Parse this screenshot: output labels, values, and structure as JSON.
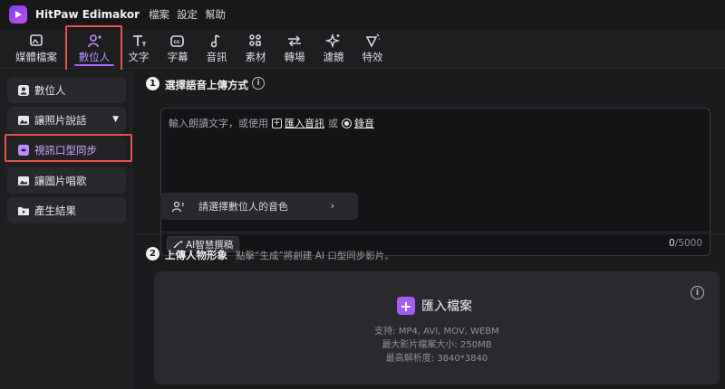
{
  "app": {
    "name": "HitPaw Edimakor"
  },
  "menu": [
    "檔案",
    "設定",
    "幫助"
  ],
  "toolbar": {
    "items": [
      {
        "label": "媒體檔案",
        "icon": "media-icon"
      },
      {
        "label": "數位人",
        "icon": "digital-human-icon"
      },
      {
        "label": "文字",
        "icon": "text-icon"
      },
      {
        "label": "字幕",
        "icon": "subtitle-icon"
      },
      {
        "label": "音訊",
        "icon": "audio-icon"
      },
      {
        "label": "素材",
        "icon": "assets-icon"
      },
      {
        "label": "轉場",
        "icon": "transition-icon"
      },
      {
        "label": "濾鏡",
        "icon": "filter-icon"
      },
      {
        "label": "特效",
        "icon": "effects-icon"
      }
    ],
    "active_index": 1
  },
  "sidebar": {
    "items": [
      {
        "label": "數位人"
      },
      {
        "label": "讓照片說話"
      },
      {
        "label": "視訊口型同步"
      },
      {
        "label": "讓圖片唱歌"
      },
      {
        "label": "產生結果"
      }
    ]
  },
  "step1": {
    "number": "1",
    "title": "選擇語音上傳方式",
    "prompt_text": "輸入朗讀文字，或使用",
    "import_audio_label": "匯入音訊",
    "or_label": "或",
    "record_label": "錄音",
    "ai_button_label": "AI智慧撰稿",
    "char_count": "0",
    "char_limit": "/5000",
    "voice_select_label": "請選擇數位人的音色"
  },
  "step2": {
    "number": "2",
    "title": "上傳人物形象",
    "hint": "點擊“生成”將創建 AI 口型同步影片。",
    "import_label": "匯入檔案",
    "supported": "支持: MP4, AVI, MOV, WEBM",
    "max_size": "最大影片檔案大小: 250MB",
    "max_resolution": "最高解析度: 3840*3840"
  },
  "colors": {
    "accent": "#a45cf5",
    "highlight": "#e8514f",
    "background": "#1b1b1d"
  }
}
